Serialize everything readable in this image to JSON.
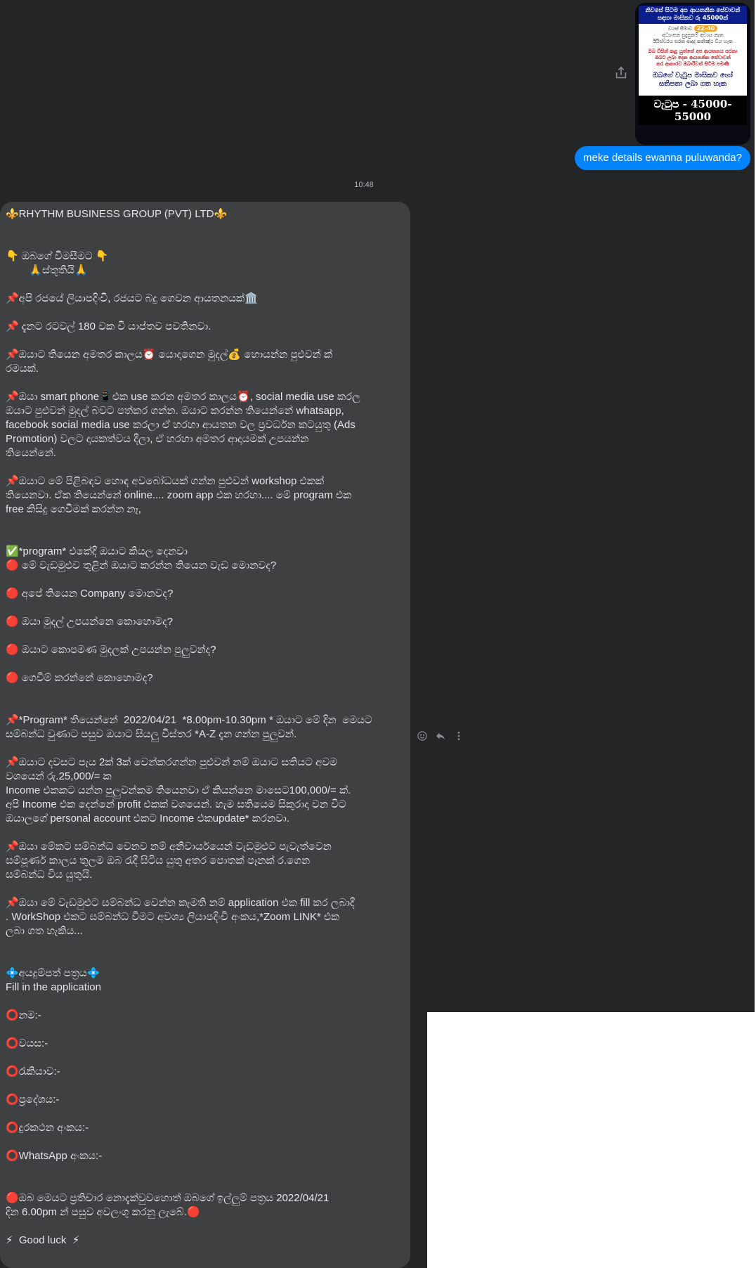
{
  "poster": {
    "top_line_1": "නිවසේ සිටම අප ආයතනික සේවාවන්",
    "top_line_2": "සඳහා මාසිකව රු 45000ක්",
    "age_label": "වයස් සීමාව",
    "age_range": "22-40",
    "mid_line_1": "අධ්‍යාපන සුදුසුකම් අවශ්‍ය නැත",
    "mid_line_2": "ඊයිස්වරය සරක ආදාද කනිඤ්ඨ විය හැක",
    "red_line_1": "ඔබ විසින් කළ යුත්තේ අප ආයතනය සරනා",
    "red_line_2": "ඔබට ලබා දෙන ආයතනික සේවාවන්",
    "red_line_3": "කර ආකාරව ඔබාරිවත් සිටීම පමණි",
    "blue_line_1": "ඔබගේ වැටුප මාසිකව හෝ",
    "blue_line_2": "සතිපතා ලබා ගත හැක",
    "salary": "වැටුප - 45000-55000"
  },
  "my_message": "meke details ewanna puluwanda?",
  "timestamp": "10:48",
  "their_message": {
    "lines": [
      "⚜️RHYTHM BUSINESS GROUP (PVT) LTD⚜️",
      "",
      "",
      "👇 ඔබගේ විමසීමට 👇",
      "        🙏ස්තූතියි🙏",
      "",
      "📌අපි රජයේ ලියාපදිංචි, රජයට බදු ගෙවන ආයතනයක්🏛️",
      "",
      "📌 දැනට රටවල් 180 වක වී යාප්තව පවතිනවා.",
      "",
      "📌ඔයාට තියෙන අමතර කාලය⏰ යොදාගෙන මුදල්💰 හොයන්න පුළුවන් ක්",
      "රමයක්.",
      "",
      "📌ඔයා smart phone📱එක use කරන අමතර කාලය⏰, social media use කරල",
      "ඔයාට පුළුවන් මුදල් බවට පත්කර ගන්න. ඔයාට කරන්න තියෙන්නේ whatsapp,",
      "facebook social media use කරලා ඒ හරහා ආයතන වල ප්‍රවර්ධන කටයුතු (Ads",
      "Promotion) වලට දායකත්වය දීලා, ඒ හරහා අමතර ආදායමක් උපයන්න",
      "තියෙන්නේ.",
      "",
      "📌ඔයාට මේ පිළිබඳව හොඳ අවබෝධයක් ගන්න පුළුවන් workshop එකක්",
      "තියෙනවා. ඒක තියෙන්නේ online.... zoom app එක හරහා.... මේ program එක",
      "free කිසිදු ගෙවීමක් කරන්න නෑ,",
      "",
      "",
      "✅*program* එකේදි ඔයාට කියල දෙනවා",
      "🔴 මේ වැඩමුළුව තුළින් ඔයාට කරන්න තියෙන වැඩ මොනවද?",
      "",
      "🔴 අපේ තියෙන Company මොනවද?",
      "",
      "🔴 ඔයා මුදල් උපයන්නෙ කොහොමද?",
      "",
      "🔴 ඔයාට කොපමණ මුදලක් උපයන්න පුලුවන්ද?",
      "",
      "🔴 ගෙවීම් කරන්නේ කොහොමද?",
      "",
      "",
      "📌*Program* තියෙන්නේ  2022/04/21  *8.00pm-10.30pm * ඔයාට මේ දින  මෙයට",
      "සම්බන්ධ වුණාට පසුව ඔයාට සියලු විස්තර *A-Z දැන ගන්න පුලුවන්.",
      "",
      "📌ඔයාට දවසට පැය 2ක් 3ක් වෙන්කරගන්න පුළුවන් නම් ඔයාට සතියට අවම",
      "වශයෙන් රු.25,000/= ක",
      "Income එකකට යන්න පුලුවන්කම තියෙනවා ඒ කියන්නෙ මාසෙට100,000/= ක්.",
      "අපි Income එක දෙන්නේ profit එකක් වශයෙන්. හැම සතියෙම සිකුරාදා වන විට",
      "ඔයාලගේ personal account එකට Income එකupdate* කරනවා.",
      "",
      "📌ඔයා මේකට සම්බන්ධ වෙනව නම් අනිවාර්යයෙන් වැඩමුළුව පැවැත්වෙන",
      "සම්පූර්ණ කාලය තුලම ඔබ රැදී සිටිය යුතු අතර පොතක් පෑනක් ර.ගෙන",
      "සම්බන්ධ විය යුතුයි.",
      "",
      "📌ඔයා මේ වැඩමුළුට සම්බන්ධ වෙන්න කැමති නම් application එක fill කර ලබාදී",
      ". WorkShop එකට සම්බන්ධ වීමට අවශ්‍ය ලියාපදිංචි අංකය,*Zoom LINK* එක",
      "ලබා ගත හැකිය...",
      "",
      "",
      "💠අයදුම්පත් පත්‍රය💠",
      "Fill in the application",
      "",
      "⭕නම:-",
      "",
      "⭕වයස:-",
      "",
      "⭕රැකියාව:-",
      "",
      "⭕ප්‍රදේශය:-",
      "",
      "⭕දුරකථන අංකය:-",
      "",
      "⭕WhatsApp අංකය:-",
      "",
      "",
      "🔴ඔබ මෙයට ප්‍රතිචාර නොදැක්වුවහොත් ඔබගේ ඉල්ලුම් පත්‍රය 2022/04/21",
      "දින 6.00pm න් පසුව අවලංගු කරනු ලැබේ.🔴",
      "",
      "⚡  Good luck  ⚡"
    ]
  },
  "icons": {
    "share": "share-icon",
    "react": "smiley-icon",
    "reply": "reply-icon",
    "more": "more-vertical-icon"
  },
  "colors": {
    "background": "#242526",
    "bubble_incoming": "#3e4042",
    "bubble_outgoing": "#0084ff",
    "text": "#e4e6eb"
  }
}
